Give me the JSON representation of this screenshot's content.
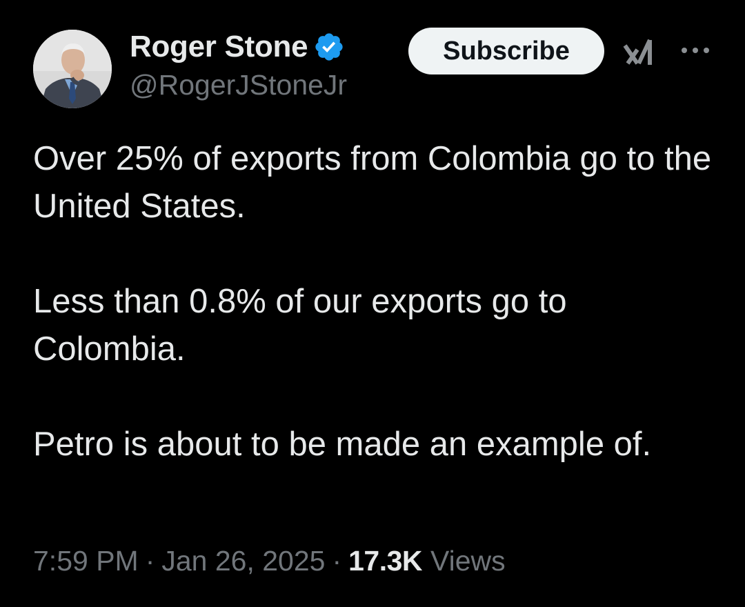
{
  "author": {
    "display_name": "Roger Stone",
    "handle": "@RogerJStoneJr",
    "verified": true,
    "avatar_icon": "profile-photo",
    "verified_color": "#1d9bf0"
  },
  "header": {
    "subscribe_label": "Subscribe",
    "grok_icon": "grok-icon",
    "more_icon": "more-horizontal-icon"
  },
  "tweet": {
    "paragraphs": [
      "Over 25% of exports from Colombia go to the United States.",
      "Less than 0.8% of our exports go to Colombia.",
      "Petro is about to be made an example of."
    ]
  },
  "meta": {
    "time": "7:59 PM",
    "separator": "·",
    "date": "Jan 26, 2025",
    "views_count": "17.3K",
    "views_label": "Views"
  },
  "colors": {
    "background": "#000000",
    "text_primary": "#e7e9ea",
    "text_secondary": "#71767b",
    "subscribe_bg": "#eff3f4"
  }
}
